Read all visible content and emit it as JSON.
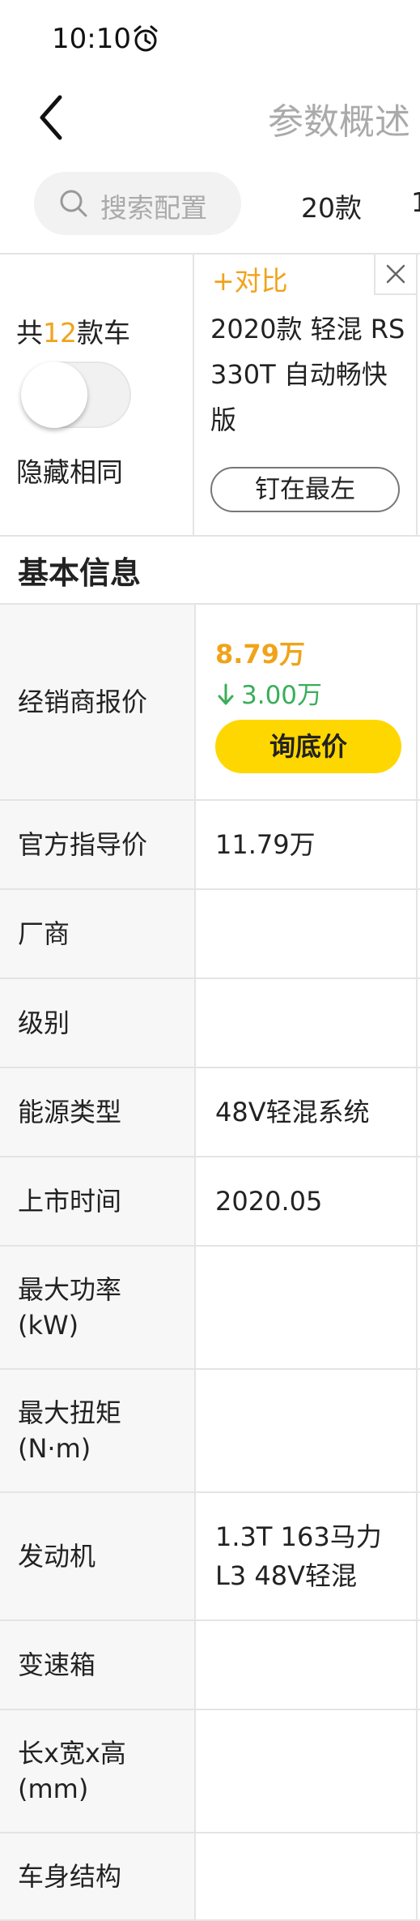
{
  "status_bar": {
    "time": "10:10"
  },
  "nav": {
    "title": "参数概述"
  },
  "search": {
    "placeholder": "搜索配置",
    "tabs": [
      "20款",
      "1"
    ]
  },
  "compare": {
    "count_prefix": "共",
    "count": "12",
    "count_suffix": "款车",
    "hide_same_label": "隐藏相同",
    "add_compare": "+对比",
    "car_name": "2020款 轻混 RS 330T 自动畅快版",
    "pin_label": "钉在最左"
  },
  "section_title": "基本信息",
  "dealer_price": {
    "label": "经销商报价",
    "price": "8.79万",
    "drop": "3.00万",
    "button": "询底价"
  },
  "params": [
    {
      "label": "官方指导价",
      "value": "11.79万"
    },
    {
      "label": "厂商",
      "value": ""
    },
    {
      "label": "级别",
      "value": ""
    },
    {
      "label": "能源类型",
      "value": "48V轻混系统"
    },
    {
      "label": "上市时间",
      "value": "2020.05"
    },
    {
      "label": "最大功率\n(kW)",
      "value": ""
    },
    {
      "label": "最大扭矩\n(N·m)",
      "value": ""
    },
    {
      "label": "发动机",
      "value": "1.3T 163马力\nL3 48V轻混"
    },
    {
      "label": "变速箱",
      "value": ""
    },
    {
      "label": "长x宽x高\n(mm)",
      "value": ""
    },
    {
      "label": "车身结构",
      "value": ""
    }
  ],
  "colors": {
    "accent_orange": "#f0a31a",
    "price_drop_green": "#3aae5a",
    "button_yellow": "#ffd700",
    "label_bg": "#f7f7f7",
    "grid_line": "#e4e4e4"
  },
  "icons": [
    "alarm-icon",
    "back-icon",
    "search-icon",
    "close-icon",
    "arrow-down-icon"
  ]
}
